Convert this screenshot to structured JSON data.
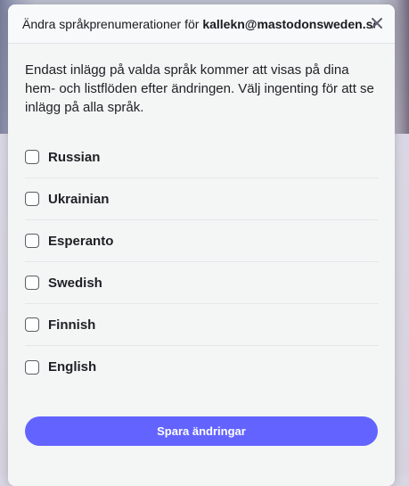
{
  "modal": {
    "title_prefix": "Ändra språkprenumerationer för ",
    "title_account": "kallekn@mastodonsweden.se",
    "close_icon": "close-icon",
    "intro": "Endast inlägg på valda språk kommer att visas på dina hem- och listflöden efter ändringen. Välj ingenting för att se inlägg på alla språk.",
    "languages": [
      {
        "label": "Russian",
        "checked": false
      },
      {
        "label": "Ukrainian",
        "checked": false
      },
      {
        "label": "Esperanto",
        "checked": false
      },
      {
        "label": "Swedish",
        "checked": false
      },
      {
        "label": "Finnish",
        "checked": false
      },
      {
        "label": "English",
        "checked": false
      }
    ],
    "save_label": "Spara ändringar"
  },
  "colors": {
    "accent": "#6364ff",
    "modal_bg": "#f4f6f6",
    "text": "#1f1f24"
  }
}
